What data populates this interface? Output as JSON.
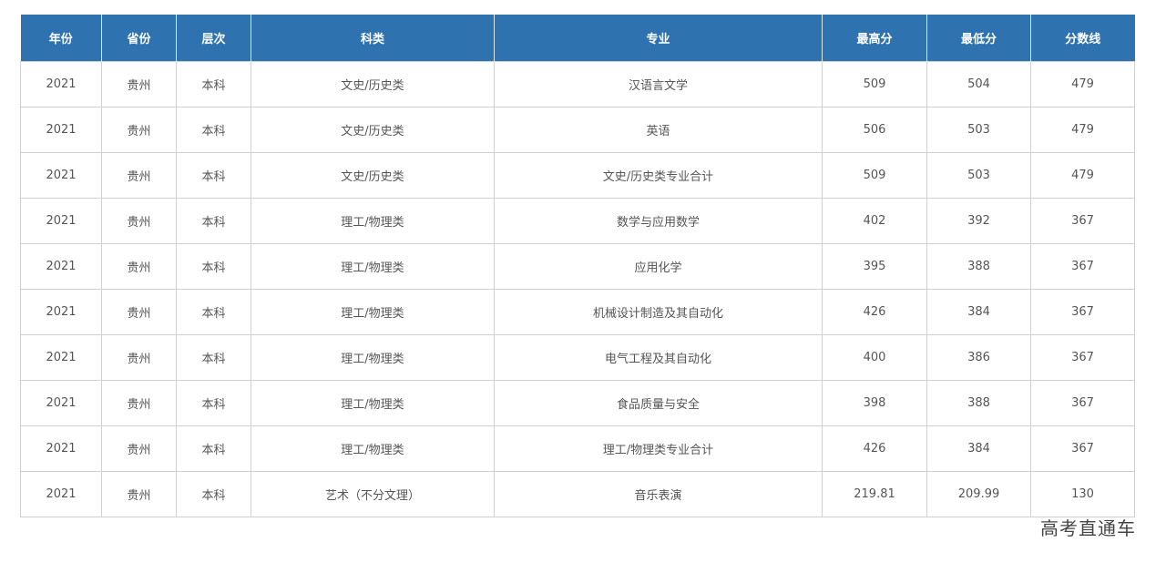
{
  "table": {
    "headers": [
      "年份",
      "省份",
      "层次",
      "科类",
      "专业",
      "最高分",
      "最低分",
      "分数线"
    ],
    "rows": [
      [
        "2021",
        "贵州",
        "本科",
        "文史/历史类",
        "汉语言文学",
        "509",
        "504",
        "479"
      ],
      [
        "2021",
        "贵州",
        "本科",
        "文史/历史类",
        "英语",
        "506",
        "503",
        "479"
      ],
      [
        "2021",
        "贵州",
        "本科",
        "文史/历史类",
        "文史/历史类专业合计",
        "509",
        "503",
        "479"
      ],
      [
        "2021",
        "贵州",
        "本科",
        "理工/物理类",
        "数学与应用数学",
        "402",
        "392",
        "367"
      ],
      [
        "2021",
        "贵州",
        "本科",
        "理工/物理类",
        "应用化学",
        "395",
        "388",
        "367"
      ],
      [
        "2021",
        "贵州",
        "本科",
        "理工/物理类",
        "机械设计制造及其自动化",
        "426",
        "384",
        "367"
      ],
      [
        "2021",
        "贵州",
        "本科",
        "理工/物理类",
        "电气工程及其自动化",
        "400",
        "386",
        "367"
      ],
      [
        "2021",
        "贵州",
        "本科",
        "理工/物理类",
        "食品质量与安全",
        "398",
        "388",
        "367"
      ],
      [
        "2021",
        "贵州",
        "本科",
        "理工/物理类",
        "理工/物理类专业合计",
        "426",
        "384",
        "367"
      ],
      [
        "2021",
        "贵州",
        "本科",
        "艺术（不分文理）",
        "音乐表演",
        "219.81",
        "209.99",
        "130"
      ]
    ]
  },
  "watermark": "高考直通车",
  "colors": {
    "header_bg": "#2e72b0",
    "header_text": "#ffffff",
    "cell_text": "#555555",
    "border": "#d0d0d0"
  }
}
